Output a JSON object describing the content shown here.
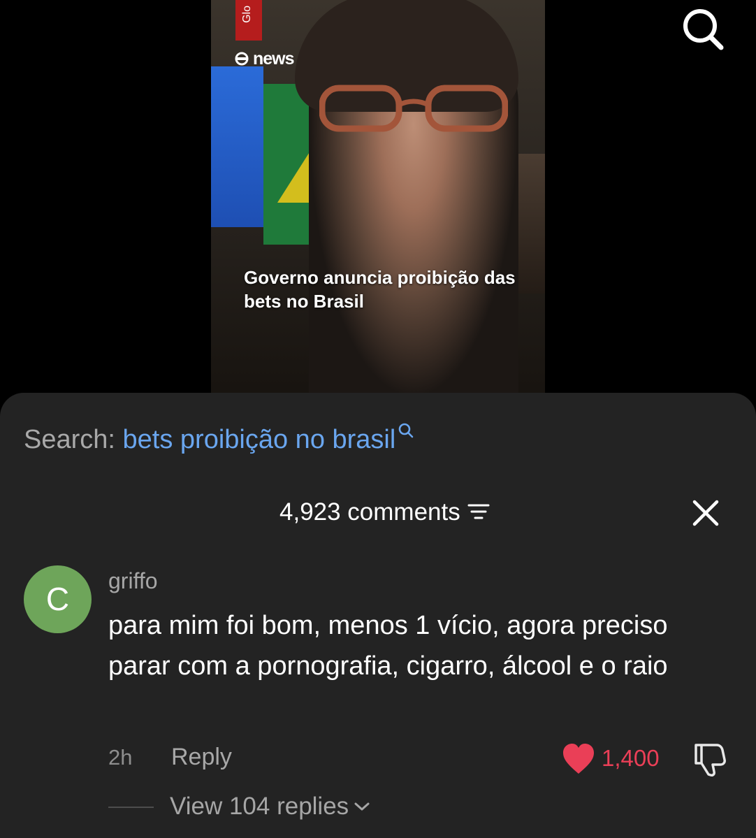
{
  "video": {
    "logo_text": "Glo",
    "channel_label": "news",
    "caption": "Governo anuncia proibição das bets no Brasil"
  },
  "search": {
    "label": "Search:",
    "query": "bets proibição no brasil"
  },
  "comments_panel": {
    "count_label": "4,923 comments"
  },
  "comment": {
    "avatar_initial": "C",
    "avatar_color": "#6ea55a",
    "username": "griffo",
    "text": "para mim foi bom, menos 1 vício, agora preciso parar com a pornografia, cigarro, álcool e o raio",
    "time": "2h",
    "reply_label": "Reply",
    "likes": "1,400",
    "view_replies_label": "View 104 replies"
  },
  "colors": {
    "accent_blue": "#6aa6ef",
    "like_red": "#ea3f57",
    "sheet_bg": "#232323"
  },
  "icons": [
    "search-icon",
    "search-query-icon",
    "filter-icon",
    "close-icon",
    "heart-icon",
    "dislike-icon",
    "chevron-down-icon"
  ]
}
